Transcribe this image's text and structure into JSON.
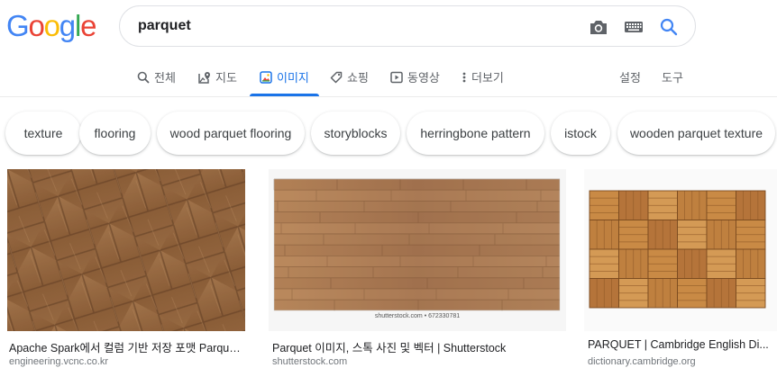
{
  "logo": {
    "letters": [
      "G",
      "o",
      "o",
      "g",
      "l",
      "e"
    ],
    "colors": [
      "#4285F4",
      "#EA4335",
      "#FBBC05",
      "#4285F4",
      "#34A853",
      "#EA4335"
    ]
  },
  "search": {
    "query": "parquet"
  },
  "tabs": [
    {
      "label": "전체",
      "icon": "search-icon"
    },
    {
      "label": "지도",
      "icon": "map-pin-icon"
    },
    {
      "label": "이미지",
      "icon": "image-icon",
      "active": true
    },
    {
      "label": "쇼핑",
      "icon": "tag-icon"
    },
    {
      "label": "동영상",
      "icon": "play-icon"
    },
    {
      "label": "더보기",
      "icon": "more-dots-icon"
    }
  ],
  "tools": {
    "settings": "설정",
    "tools": "도구"
  },
  "chips": [
    "texture",
    "flooring",
    "wood parquet flooring",
    "storyblocks",
    "herringbone pattern",
    "istock",
    "wooden parquet texture"
  ],
  "results": [
    {
      "title": "Apache Spark에서 컬럼 기반 저장 포맷 Parquet(...",
      "source": "engineering.vcnc.co.kr"
    },
    {
      "title": "Parquet 이미지, 스톡 사진 및 벡터 | Shutterstock",
      "source": "shutterstock.com",
      "watermark": "shutterstock.com • 672330781"
    },
    {
      "title": "PARQUET | Cambridge English Di...",
      "source": "dictionary.cambridge.org"
    }
  ],
  "colors": {
    "accent": "#1a73e8",
    "text": "#202124",
    "muted": "#5f6368"
  }
}
